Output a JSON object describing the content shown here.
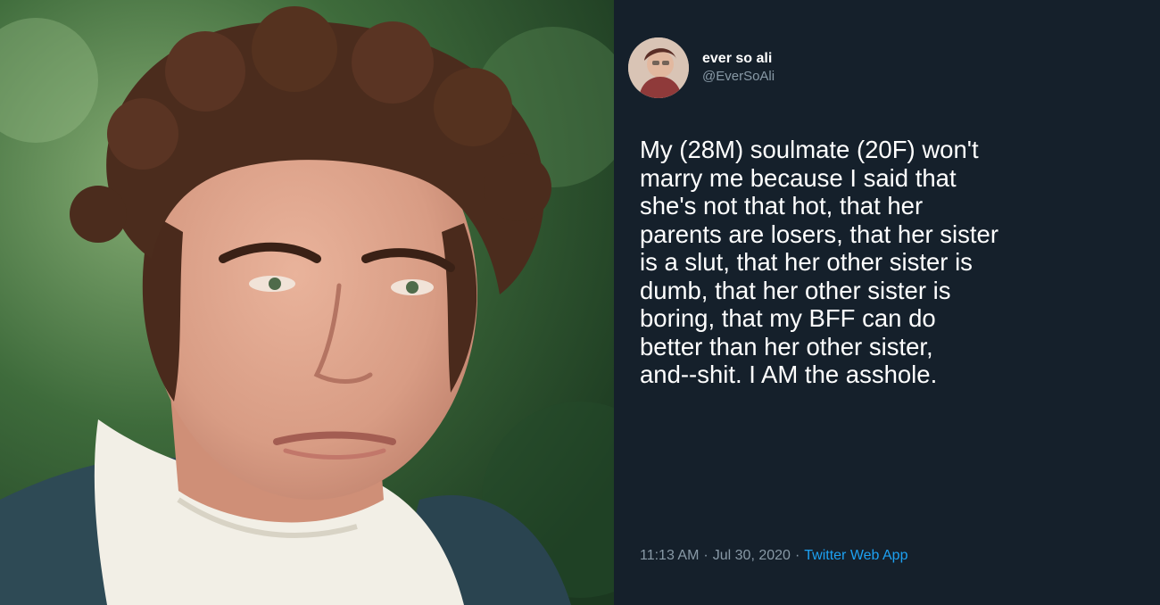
{
  "photo": {
    "icon": "portrait-photo"
  },
  "tweet": {
    "author": {
      "display_name": "ever so ali",
      "handle": "@EverSoAli",
      "avatar_icon": "profile-avatar"
    },
    "text": "My (28M) soulmate (20F) won't\nmarry me because I said that\nshe's not that hot, that her\nparents are losers, that her sister\nis a slut, that her other sister is\ndumb, that her other sister is\nboring, that my BFF can do\nbetter than her other sister,\nand--shit. I AM the asshole.",
    "time": "11:13 AM",
    "separator": "·",
    "date": "Jul 30, 2020",
    "source": "Twitter Web App"
  },
  "colors": {
    "background": "#15202b",
    "text": "#ffffff",
    "secondary_text": "#8899a6",
    "link": "#1da1f2"
  }
}
